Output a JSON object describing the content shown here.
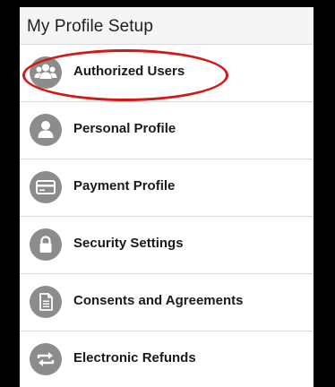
{
  "panel": {
    "title": "My Profile Setup"
  },
  "menu": {
    "items": [
      {
        "label": "Authorized Users",
        "icon": "users-group-icon"
      },
      {
        "label": "Personal Profile",
        "icon": "person-icon"
      },
      {
        "label": "Payment Profile",
        "icon": "credit-card-icon"
      },
      {
        "label": "Security Settings",
        "icon": "lock-icon"
      },
      {
        "label": "Consents and Agreements",
        "icon": "document-icon"
      },
      {
        "label": "Electronic Refunds",
        "icon": "refund-arrows-icon"
      }
    ]
  },
  "colors": {
    "icon_circle": "#8c8c8c",
    "highlight_ring": "#d31818",
    "background_frame": "#000000"
  }
}
